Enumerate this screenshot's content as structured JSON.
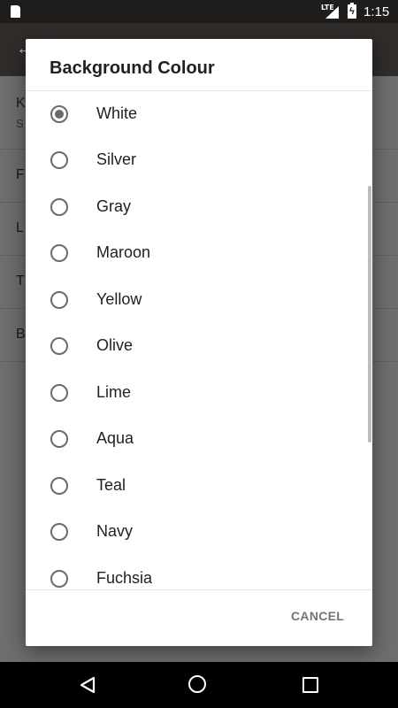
{
  "status_bar": {
    "network": "LTE",
    "time": "1:15"
  },
  "background_screen": {
    "rows": [
      {
        "label": "K",
        "sub": "S"
      },
      {
        "label": "F"
      },
      {
        "label": "L"
      },
      {
        "label": "T"
      },
      {
        "label": "B"
      }
    ]
  },
  "dialog": {
    "title": "Background Colour",
    "selected": "White",
    "options": [
      {
        "label": "White",
        "checked": true
      },
      {
        "label": "Silver",
        "checked": false
      },
      {
        "label": "Gray",
        "checked": false
      },
      {
        "label": "Maroon",
        "checked": false
      },
      {
        "label": "Yellow",
        "checked": false
      },
      {
        "label": "Olive",
        "checked": false
      },
      {
        "label": "Lime",
        "checked": false
      },
      {
        "label": "Aqua",
        "checked": false
      },
      {
        "label": "Teal",
        "checked": false
      },
      {
        "label": "Navy",
        "checked": false
      },
      {
        "label": "Fuchsia",
        "checked": false
      }
    ],
    "cancel_label": "CANCEL"
  },
  "icons": {
    "status": [
      "sd-card-icon",
      "signal-icon",
      "battery-charging-icon"
    ],
    "nav": [
      "back-icon",
      "home-icon",
      "recents-icon"
    ]
  },
  "colors": {
    "radio": "#6b6b6b",
    "dialog_bg": "#ffffff",
    "scrim": "#6e6e6e",
    "nav_bg": "#000000",
    "status_bg": "#1f1d1b"
  }
}
